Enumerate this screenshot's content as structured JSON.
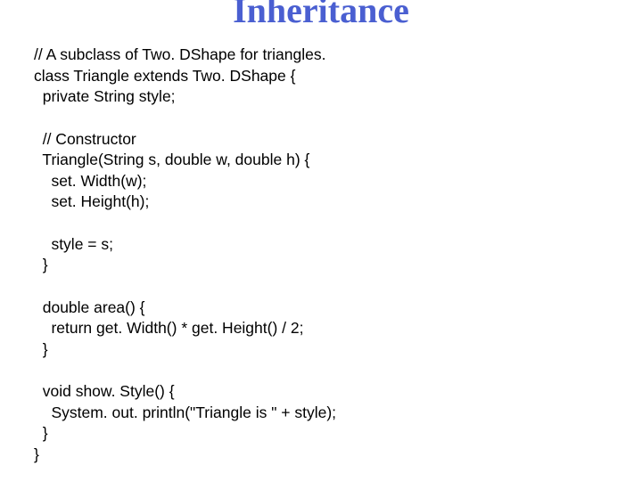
{
  "title": "Inheritance",
  "code": "// A subclass of Two. DShape for triangles.\nclass Triangle extends Two. DShape {\n  private String style;\n\n  // Constructor\n  Triangle(String s, double w, double h) {\n    set. Width(w);\n    set. Height(h);\n\n    style = s;\n  }\n\n  double area() {\n    return get. Width() * get. Height() / 2;\n  }\n\n  void show. Style() {\n    System. out. println(\"Triangle is \" + style);\n  }\n}"
}
